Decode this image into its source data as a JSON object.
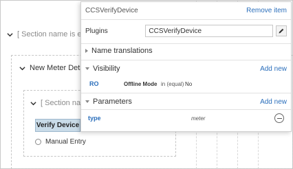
{
  "canvas": {
    "outer_section_label": "[ Section name is emp",
    "meter_details_label": "New Meter Details",
    "inner_section_label": "[ Section nam",
    "verify_button_label": "Verify Device",
    "manual_entry_label": "Manual Entry"
  },
  "panel": {
    "title": "CCSVerifyDevice",
    "remove_label": "Remove item",
    "plugins": {
      "label": "Plugins",
      "value": "CCSVerifyDevice"
    },
    "name_translations_label": "Name translations",
    "visibility": {
      "title": "Visibility",
      "add_label": "Add new",
      "rule": {
        "name": "RO",
        "field": "Offline Mode",
        "operator": "in (equal)",
        "value": "No"
      }
    },
    "parameters": {
      "title": "Parameters",
      "add_label": "Add new",
      "rows": [
        {
          "name": "type",
          "value": "meter"
        }
      ]
    }
  },
  "colors": {
    "link": "#2a6ebb",
    "verify_button_bg": "#c9dbe8"
  }
}
